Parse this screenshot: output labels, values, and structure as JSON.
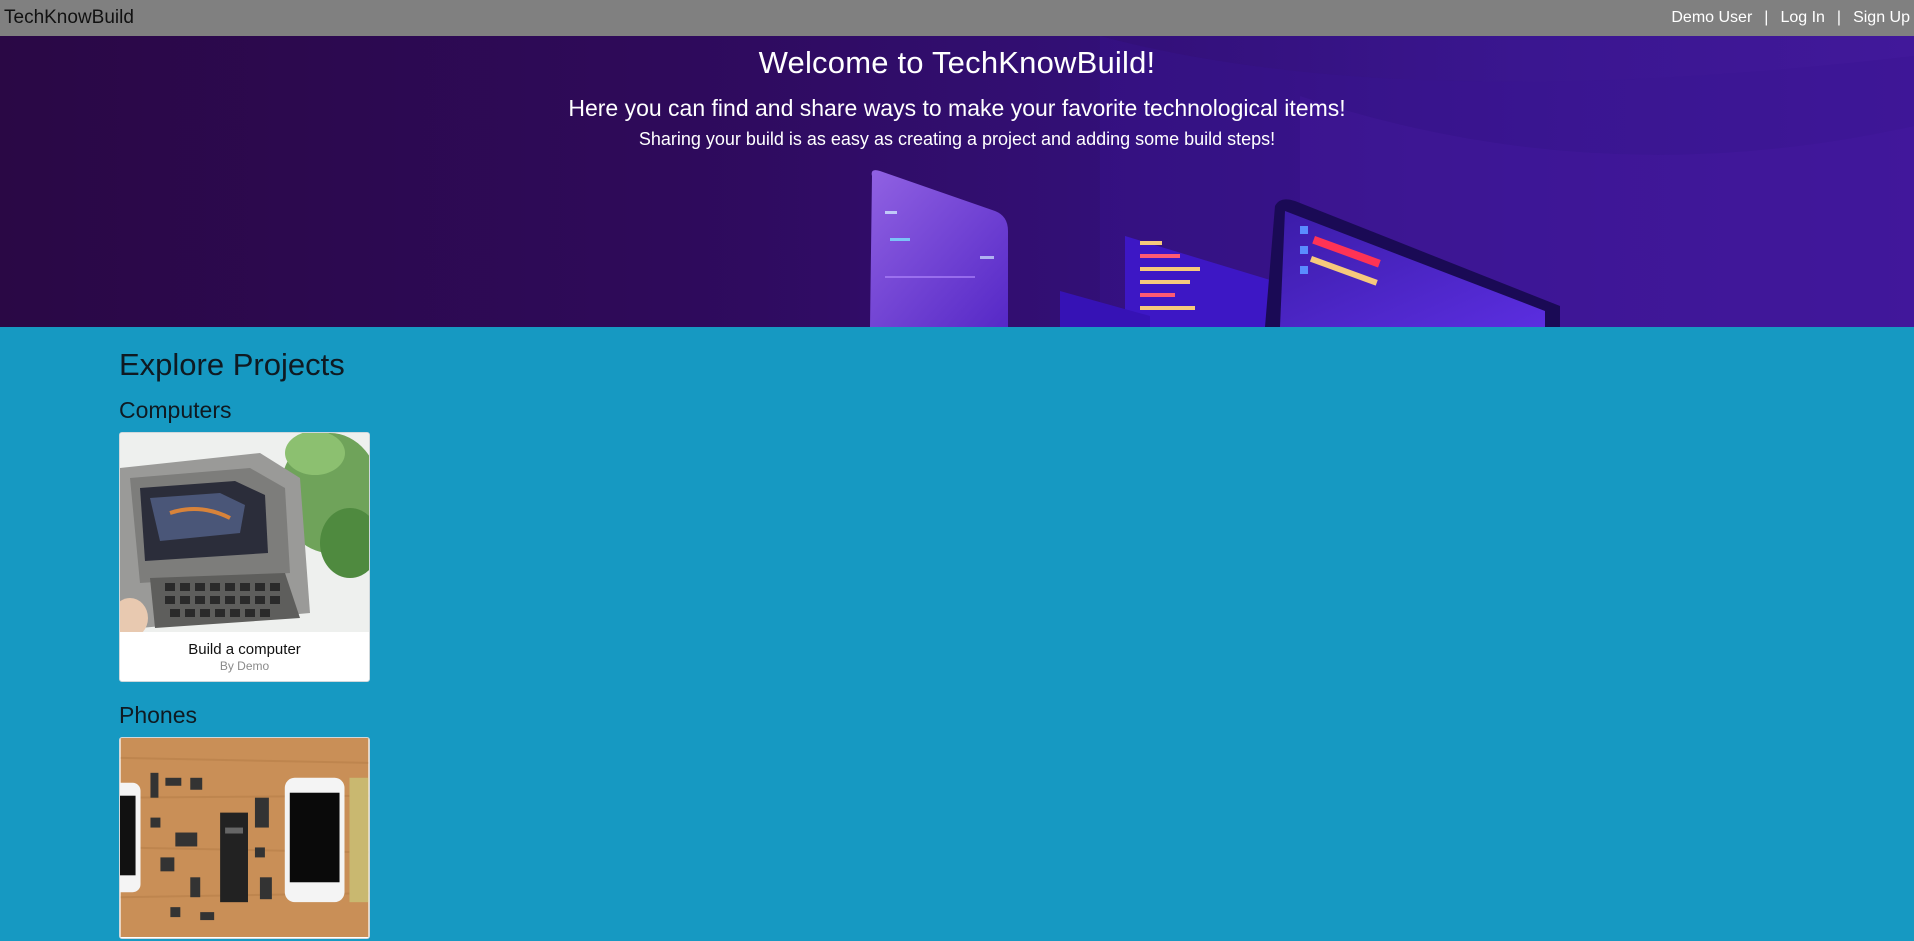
{
  "nav": {
    "brand": "TechKnowBuild",
    "user": "Demo User",
    "separator": "|",
    "login": "Log In",
    "signup": "Sign Up"
  },
  "hero": {
    "title": "Welcome to TechKnowBuild!",
    "subtitle": "Here you can find and share ways to make your favorite technological items!",
    "tagline": "Sharing your build is as easy as creating a project and adding some build steps!"
  },
  "explore": {
    "title": "Explore Projects",
    "categories": [
      {
        "name": "Computers",
        "projects": [
          {
            "title": "Build a computer",
            "author": "By Demo"
          }
        ]
      },
      {
        "name": "Phones",
        "projects": [
          {
            "title": "",
            "author": ""
          }
        ]
      }
    ]
  },
  "colors": {
    "navbar": "#808080",
    "page_background": "#1699c2",
    "hero_background": "#2e0a5a"
  }
}
